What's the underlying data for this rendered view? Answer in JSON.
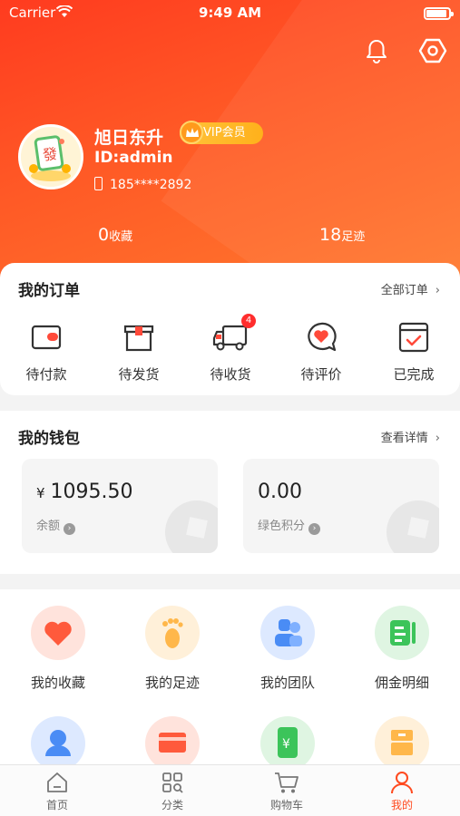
{
  "status_bar": {
    "carrier": "Carrier",
    "time": "9:49 AM"
  },
  "profile": {
    "name": "旭日东升",
    "vip_label": "VIP会员",
    "id": "ID:admin",
    "phone": "185****2892",
    "stats": [
      {
        "value": "0",
        "label": "收藏"
      },
      {
        "value": "18",
        "label": "足迹"
      }
    ]
  },
  "orders": {
    "title": "我的订单",
    "more": "全部订单",
    "items": [
      {
        "label": "待付款",
        "icon": "wallet-icon"
      },
      {
        "label": "待发货",
        "icon": "box-icon"
      },
      {
        "label": "待收货",
        "icon": "truck-icon",
        "badge": "4"
      },
      {
        "label": "待评价",
        "icon": "comment-heart-icon"
      },
      {
        "label": "已完成",
        "icon": "check-calendar-icon"
      }
    ]
  },
  "wallet": {
    "title": "我的钱包",
    "more": "查看详情",
    "currency": "¥",
    "balance_value": "1095.50",
    "balance_label": "余额",
    "points_value": "0.00",
    "points_label": "绿色积分"
  },
  "services": [
    {
      "label": "我的收藏",
      "icon": "heart-icon",
      "color": "#ff5a3c"
    },
    {
      "label": "我的足迹",
      "icon": "footprint-icon",
      "color": "#ffb74a"
    },
    {
      "label": "我的团队",
      "icon": "team-icon",
      "color": "#4a8cf5"
    },
    {
      "label": "佣金明细",
      "icon": "commission-icon",
      "color": "#3cc45a"
    },
    {
      "label": "",
      "icon": "user-icon",
      "color": "#4a8cf5"
    },
    {
      "label": "",
      "icon": "card-icon",
      "color": "#ff5a3c"
    },
    {
      "label": "",
      "icon": "yuan-icon",
      "color": "#3cc45a"
    },
    {
      "label": "",
      "icon": "drawer-icon",
      "color": "#ffb74a"
    }
  ],
  "tabbar": [
    {
      "label": "首页",
      "icon": "home-icon"
    },
    {
      "label": "分类",
      "icon": "category-icon"
    },
    {
      "label": "购物车",
      "icon": "cart-icon"
    },
    {
      "label": "我的",
      "icon": "profile-icon",
      "active": true
    }
  ],
  "colors": {
    "primary": "#ff4a1f",
    "vip_gold": "#ffb11b"
  }
}
